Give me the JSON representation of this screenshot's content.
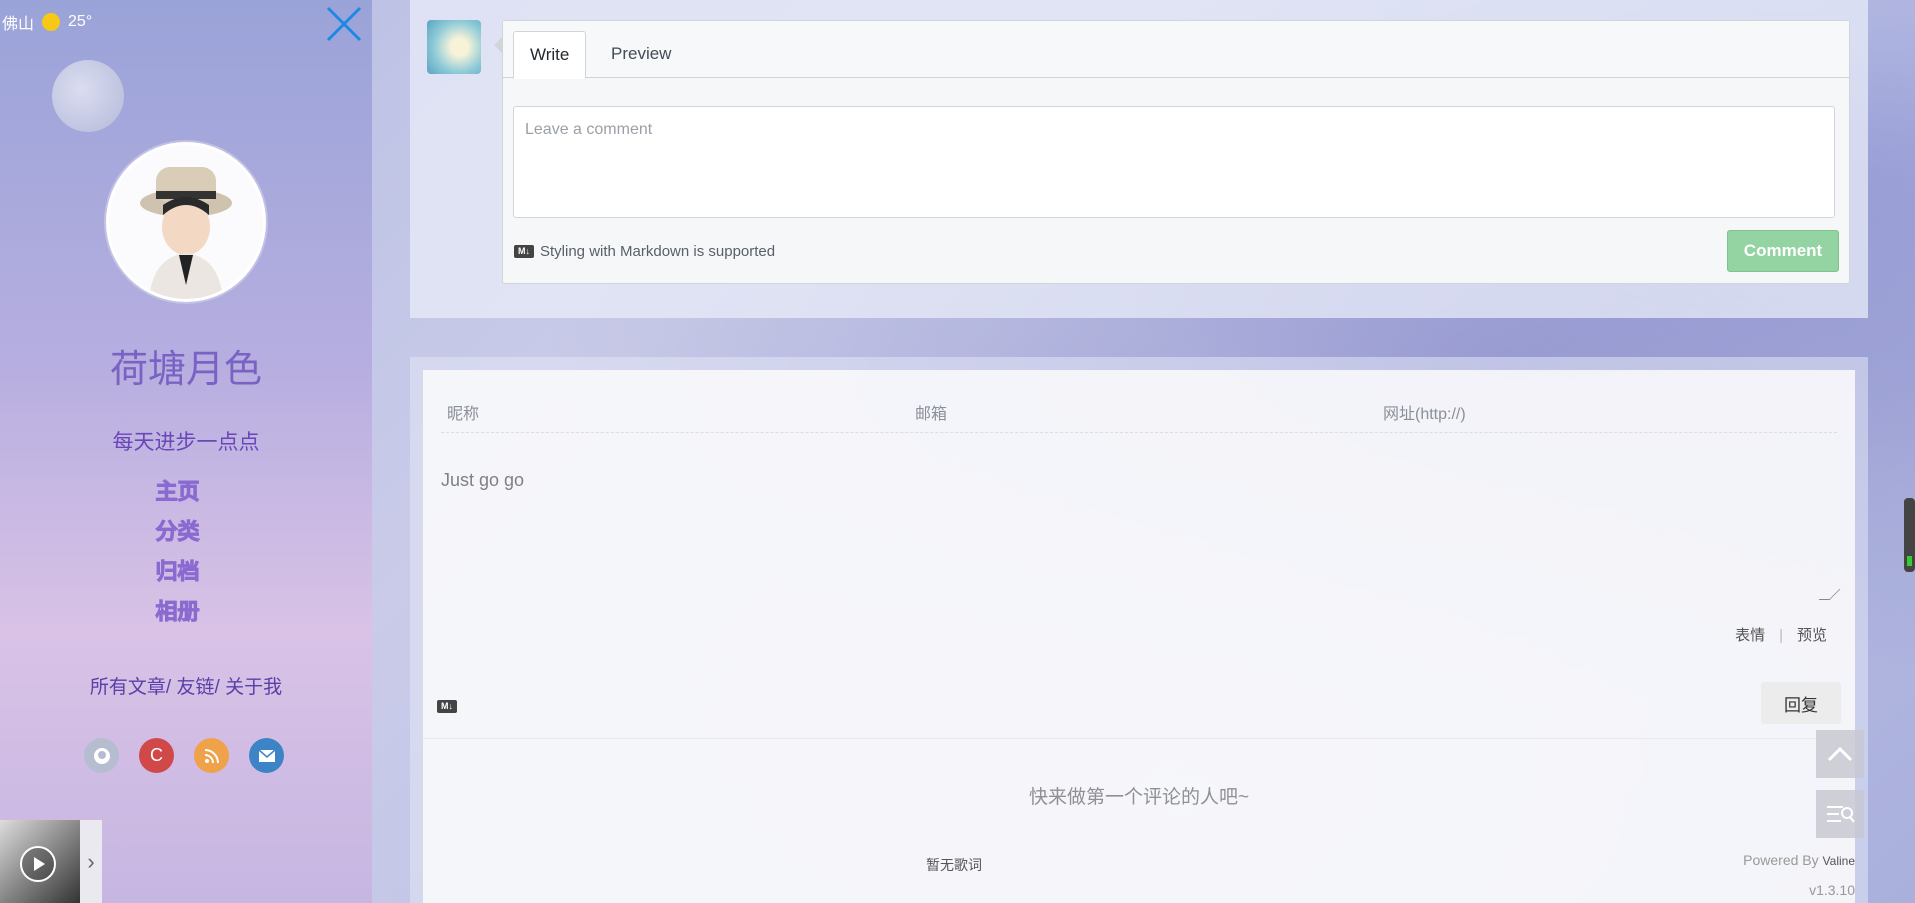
{
  "weather": {
    "city": "佛山",
    "temp": "25°",
    "icon": "sun-icon"
  },
  "sidebar": {
    "title": "荷塘月色",
    "subtitle": "每天进步一点点",
    "nav": [
      {
        "label": "主页"
      },
      {
        "label": "分类"
      },
      {
        "label": "归档"
      },
      {
        "label": "相册"
      }
    ],
    "links": [
      {
        "label": "所有文章"
      },
      {
        "label": "友链"
      },
      {
        "label": "关于我"
      }
    ],
    "link_separator": "/",
    "socials": [
      {
        "name": "github-icon",
        "color": "#b7bdd1"
      },
      {
        "name": "csdn-icon",
        "label": "C",
        "color": "#d04848"
      },
      {
        "name": "rss-icon",
        "color": "#f0a24a"
      },
      {
        "name": "email-icon",
        "color": "#3d84c6"
      }
    ]
  },
  "editor": {
    "tabs": [
      {
        "label": "Write"
      },
      {
        "label": "Preview"
      }
    ],
    "placeholder": "Leave a comment",
    "markdown_note": "Styling with Markdown is supported",
    "markdown_badge": "M↓",
    "submit_label": "Comment"
  },
  "valine": {
    "fields": {
      "nick": "昵称",
      "mail": "邮箱",
      "link": "网址(http://)"
    },
    "textarea": "Just go go",
    "tools": {
      "emoji": "表情",
      "separator": "|",
      "preview": "预览"
    },
    "markdown_badge": "M↓",
    "reply_label": "回复",
    "empty_text": "快来做第一个评论的人吧~",
    "lyric_text": "暂无歌词",
    "powered_prefix": "Powered By",
    "powered_name": "Valine",
    "version": "v1.3.10"
  },
  "colors": {
    "accent": "#7a62c4",
    "comment_button": "#94d3a2",
    "close_icon": "#1e88e5"
  }
}
